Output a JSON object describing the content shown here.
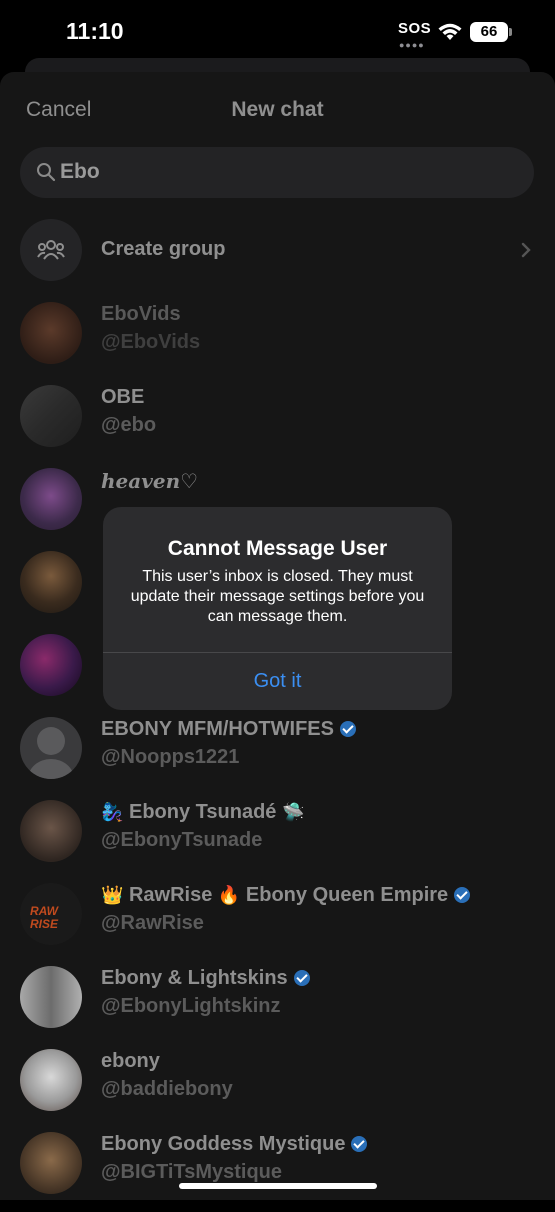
{
  "status_bar": {
    "time": "11:10",
    "sos": "SOS",
    "battery": "66"
  },
  "header": {
    "cancel_label": "Cancel",
    "title": "New chat"
  },
  "search": {
    "value": "Ebo"
  },
  "create_group": {
    "label": "Create group"
  },
  "results": [
    {
      "name": "EboVids",
      "handle": "@EboVids",
      "verified": false
    },
    {
      "name": "OBE",
      "handle": "@ebo",
      "verified": false
    },
    {
      "name": "heaven♡",
      "handle": "",
      "verified": false
    },
    {
      "name": "",
      "handle": "",
      "verified": false
    },
    {
      "name": "",
      "handle": "",
      "verified": false
    },
    {
      "name": "EBONY MFM/HOTWIFES",
      "handle": "@Noopps1221",
      "verified": true
    },
    {
      "name": "Ebony Tsunadé",
      "prefix_emoji": "🧞‍♀️",
      "suffix_emoji": "🛸",
      "handle": "@EbonyTsunade",
      "verified": false
    },
    {
      "name_part1": "RawRise",
      "name_part2": "Ebony Queen Empire",
      "prefix_emoji": "👑",
      "mid_emoji": "🔥",
      "handle": "@RawRise",
      "verified": true,
      "avatar_text": "RAW RISE"
    },
    {
      "name": "Ebony & Lightskins",
      "handle": "@EbonyLightskinz",
      "verified": true
    },
    {
      "name": "ebony",
      "handle": "@baddiebony",
      "verified": false
    },
    {
      "name": "Ebony Goddess Mystique",
      "handle": "@BIGTiTsMystique",
      "verified": true
    }
  ],
  "alert": {
    "title": "Cannot Message User",
    "message": "This user’s inbox is closed. They must update their message settings before you can message them.",
    "button": "Got it"
  },
  "colors": {
    "accent": "#3b8ff2",
    "verified": "#2a6fb8",
    "background": "#000000"
  }
}
